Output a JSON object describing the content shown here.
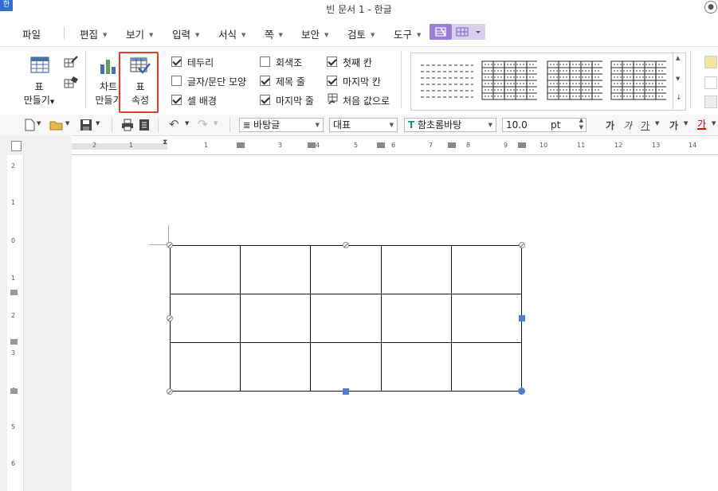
{
  "window": {
    "title": "빈 문서 1 - 한글",
    "app_icon": "한",
    "user_icon": "user-icon"
  },
  "menu": {
    "file": "파일",
    "items": [
      "편집",
      "보기",
      "입력",
      "서식",
      "쪽",
      "보안",
      "검토",
      "도구"
    ]
  },
  "ribbon": {
    "table_make": {
      "line1": "표",
      "line2": "만들기"
    },
    "chart_make": {
      "line1": "차트",
      "line2": "만들기"
    },
    "table_props": {
      "line1": "표",
      "line2": "속성"
    },
    "checks": [
      {
        "label": "테두리",
        "checked": true
      },
      {
        "label": "글자/문단 모양",
        "checked": false
      },
      {
        "label": "셀 배경",
        "checked": true
      },
      {
        "label": "회색조",
        "checked": false
      },
      {
        "label": "제목 줄",
        "checked": true
      },
      {
        "label": "마지막 줄",
        "checked": true
      },
      {
        "label": "첫째 칸",
        "checked": true
      },
      {
        "label": "마지막 칸",
        "checked": true
      }
    ],
    "reset": "처음 값으로"
  },
  "toolbar": {
    "style": "바탕글",
    "lang": "대표",
    "font": "함초롬바탕",
    "size": "10.0",
    "unit": "pt",
    "bold": "가",
    "italic": "가",
    "underline": "가",
    "strike": "가",
    "color": "가"
  },
  "ruler": {
    "h_ticks": [
      "2",
      "1",
      "1",
      "2",
      "3",
      "4",
      "5",
      "6",
      "7",
      "8",
      "9",
      "10",
      "11",
      "12",
      "13",
      "14"
    ],
    "v_ticks": [
      "2",
      "1",
      "0",
      "1",
      "2",
      "3",
      "4",
      "5",
      "6"
    ]
  },
  "document": {
    "table_rows": 3,
    "table_cols": 5
  },
  "colors": {
    "accent": "#4f7bd0",
    "highlight": "#e53b2c",
    "mode_active": "#9b7fd6"
  }
}
